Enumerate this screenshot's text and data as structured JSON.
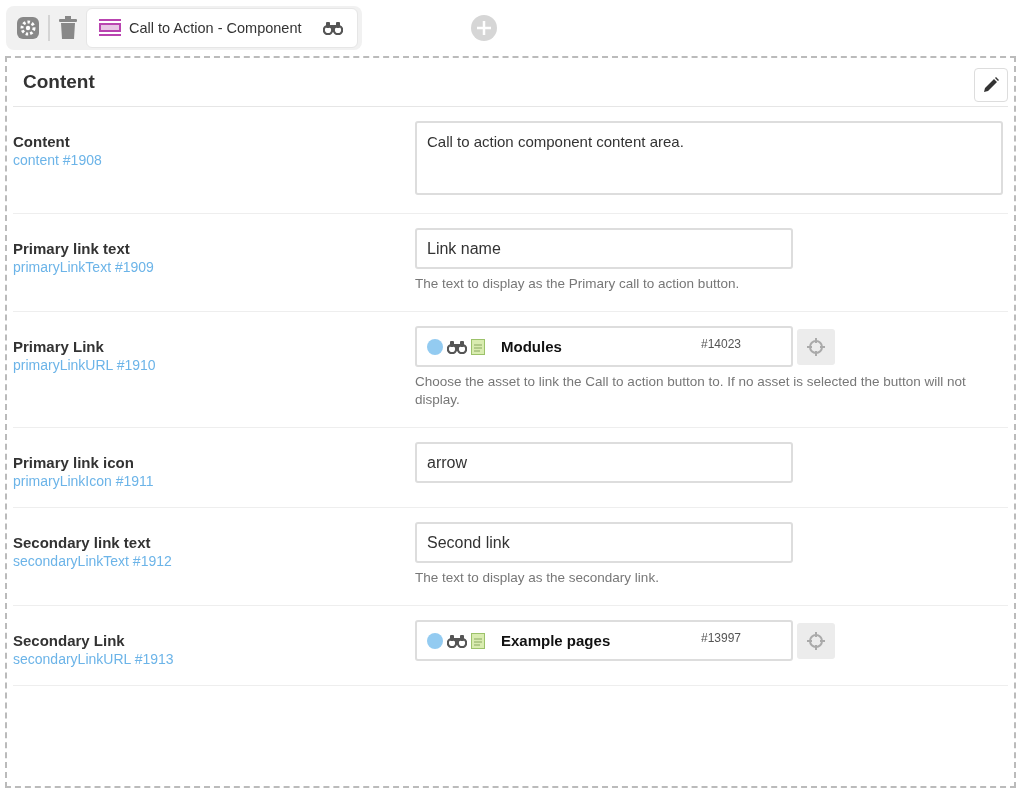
{
  "toolbar": {
    "tab_title": "Call to Action - Component"
  },
  "section": {
    "title": "Content"
  },
  "fields": [
    {
      "kind": "textarea",
      "label": "Content",
      "variable": "content #1908",
      "value": "Call to action component content area."
    },
    {
      "kind": "text",
      "label": "Primary link text",
      "variable": "primaryLinkText #1909",
      "value": "Link name",
      "help": "The text to display as the Primary call to action button."
    },
    {
      "kind": "asset",
      "label": "Primary Link",
      "variable": "primaryLinkURL #1910",
      "asset_name": "Modules",
      "asset_id": "#14023",
      "help": "Choose the asset to link the Call to action button to. If no asset is selected the button will not display."
    },
    {
      "kind": "text",
      "label": "Primary link icon",
      "variable": "primaryLinkIcon #1911",
      "value": "arrow"
    },
    {
      "kind": "text",
      "label": "Secondary link text",
      "variable": "secondaryLinkText #1912",
      "value": "Second link",
      "help": "The text to display as the secondary link."
    },
    {
      "kind": "asset",
      "label": "Secondary Link",
      "variable": "secondaryLinkURL #1913",
      "asset_name": "Example pages",
      "asset_id": "#13997"
    }
  ]
}
